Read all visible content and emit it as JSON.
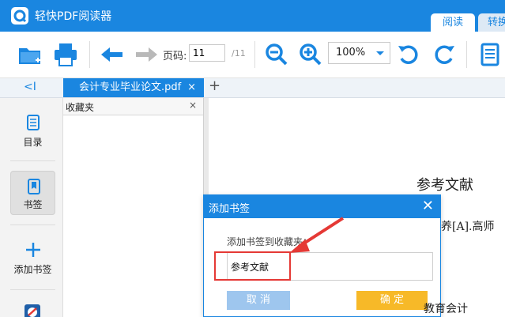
{
  "app": {
    "title": "轻快PDF阅读器",
    "modes": [
      "阅读",
      "转换"
    ]
  },
  "toolbar": {
    "page_label": "页码:",
    "page_value": "11",
    "page_total": "/11",
    "zoom_value": "100%",
    "icons": [
      "open-folder-icon",
      "print-icon",
      "back-arrow-icon",
      "forward-arrow-icon",
      "zoom-out-icon",
      "zoom-in-icon",
      "rotate-left-icon",
      "rotate-right-icon",
      "notes-icon"
    ]
  },
  "tabs": {
    "collapse": "<I",
    "document": "会计专业毕业论文.pdf",
    "close": "×",
    "add": "+"
  },
  "sidebar": {
    "items": [
      {
        "label": "目录",
        "icon": "toc-icon"
      },
      {
        "label": "书签",
        "icon": "bookmark-icon"
      },
      {
        "label": "添加书签",
        "icon": "add-bookmark-icon"
      }
    ]
  },
  "bookmark_panel": {
    "title": "收藏夹",
    "close": "×"
  },
  "document": {
    "heading": "参考文献",
    "line1": "素养[A].高师",
    "line2": "教育会计"
  },
  "dialog": {
    "title": "添加书签",
    "close": "✕",
    "label": "添加书签到收藏夹：",
    "input_value": "参考文献",
    "cancel": "取 消",
    "ok": "确 定"
  },
  "colors": {
    "brand": "#1a86e0",
    "highlight": "#e53935",
    "ok_button": "#f7b928"
  }
}
